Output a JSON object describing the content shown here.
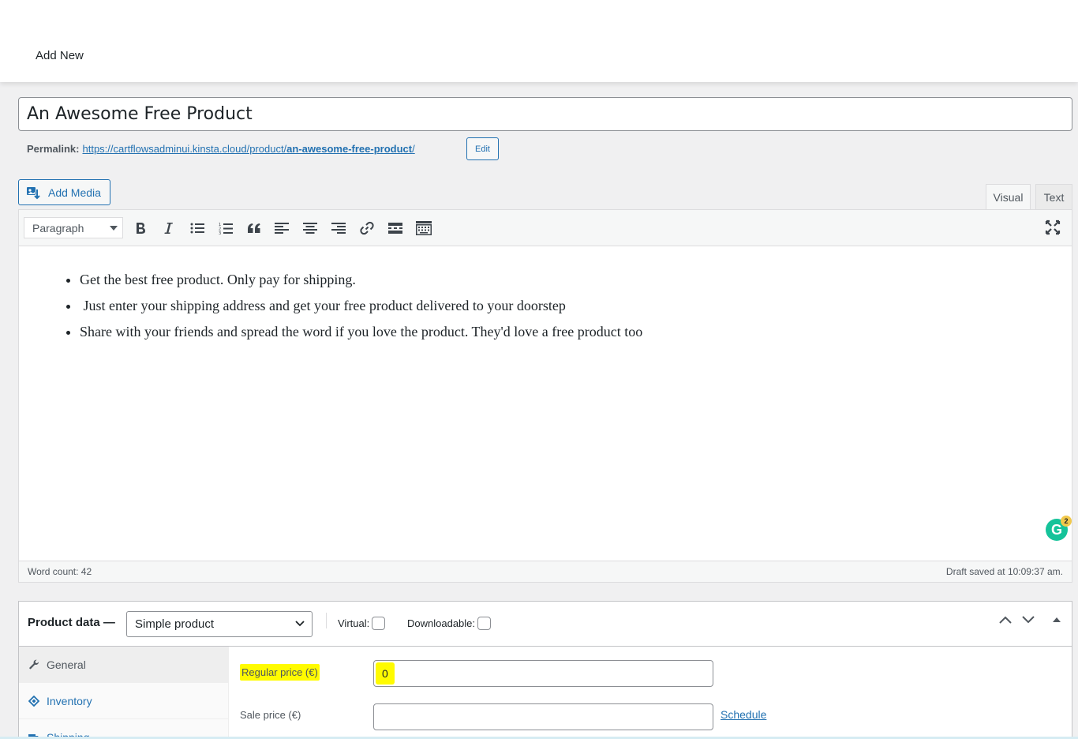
{
  "header": {
    "title": "Add New"
  },
  "post": {
    "title": "An Awesome Free Product",
    "permalink_label": "Permalink:",
    "permalink_base": "https://cartflowsadminui.kinsta.cloud/product/",
    "permalink_slug": "an-awesome-free-product",
    "permalink_trail": "/",
    "edit_label": "Edit"
  },
  "editor": {
    "add_media_label": "Add Media",
    "tabs": {
      "visual": "Visual",
      "text": "Text"
    },
    "format_select": "Paragraph",
    "toolbar_icons": [
      "bold-icon",
      "italic-icon",
      "bullet-list-icon",
      "numbered-list-icon",
      "blockquote-icon",
      "align-left-icon",
      "align-center-icon",
      "align-right-icon",
      "link-icon",
      "read-more-icon",
      "toolbar-toggle-icon",
      "fullscreen-icon"
    ],
    "bullets": [
      "Get the best free product. Only pay for shipping.",
      " Just enter your shipping address and get your free product delivered to your doorstep",
      "Share with your friends and spread the word if you love the product. They'd love a free product too"
    ],
    "grammarly": {
      "letter": "G",
      "badge": "2"
    },
    "word_count": "Word count: 42",
    "draft_saved": "Draft saved at 10:09:37 am."
  },
  "product_data": {
    "label": "Product data —",
    "type_selected": "Simple product",
    "virtual_label": "Virtual:",
    "downloadable_label": "Downloadable:",
    "tabs": [
      {
        "label": "General",
        "icon": "wrench-icon"
      },
      {
        "label": "Inventory",
        "icon": "tag-icon"
      },
      {
        "label": "Shipping",
        "icon": "truck-icon"
      }
    ],
    "regular_price_label": "Regular price (€)",
    "regular_price_value": "0",
    "sale_price_label": "Sale price (€)",
    "sale_price_value": "",
    "schedule_label": "Schedule"
  },
  "colors": {
    "accent": "#2271b1",
    "highlight": "#fffb00",
    "grammarly": "#15c39a"
  }
}
